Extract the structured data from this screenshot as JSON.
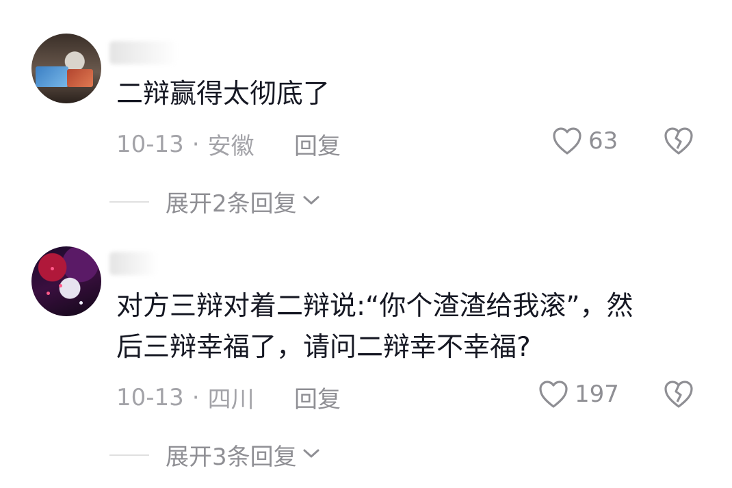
{
  "comments": [
    {
      "text_lines": [
        "二辩赢得太彻底了"
      ],
      "date": "10-13",
      "location": "安徽",
      "reply_label": "回复",
      "likes": "63",
      "expand_label": "展开2条回复"
    },
    {
      "text_lines": [
        "对方三辩对着二辩说:“你个渣渣给我滚”，然",
        "后三辩幸福了，请问二辩幸不幸福?"
      ],
      "date": "10-13",
      "location": "四川",
      "reply_label": "回复",
      "likes": "197",
      "expand_label": "展开3条回复"
    }
  ],
  "icons": {
    "like": "heart-outline-icon",
    "dislike": "broken-heart-icon",
    "expand": "chevron-down-icon"
  },
  "colors": {
    "text": "#161823",
    "meta": "#a3a3a8",
    "action": "#8f8f94"
  }
}
